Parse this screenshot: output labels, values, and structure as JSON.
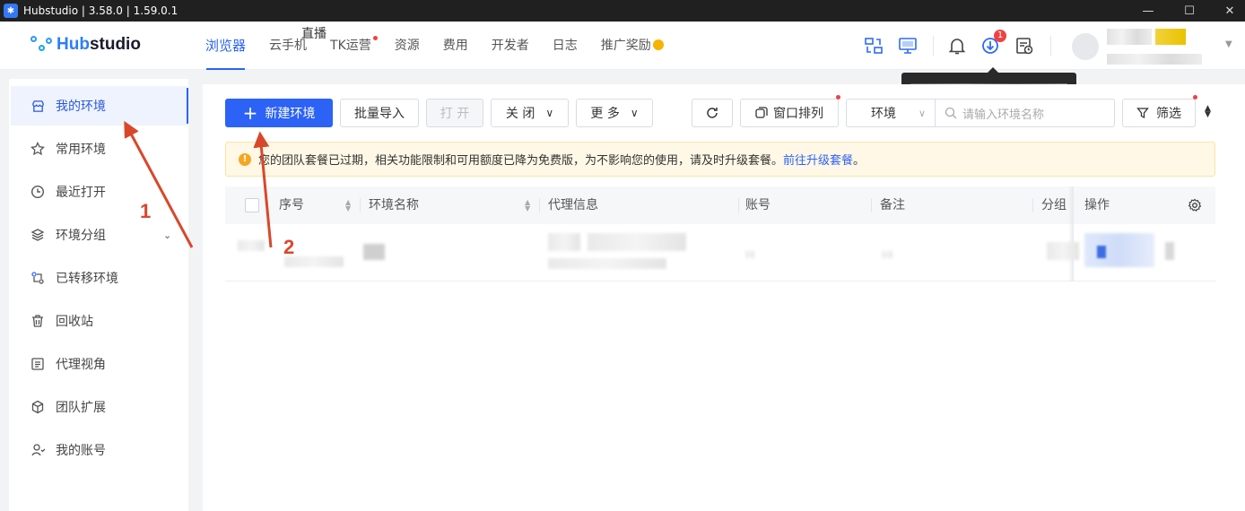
{
  "titlebar": {
    "title": "Hubstudio | 3.58.0 | 1.59.0.1",
    "minimize": "—",
    "maximize": "☐",
    "close": "✕"
  },
  "logo": {
    "prefix": "Hub",
    "suffix": "studio"
  },
  "nav": {
    "items": [
      {
        "label": "浏览器"
      },
      {
        "label": "云手机"
      },
      {
        "label": "TK运营"
      },
      {
        "label": "资源"
      },
      {
        "label": "费用"
      },
      {
        "label": "开发者"
      },
      {
        "label": "日志"
      },
      {
        "label": "推广奖励"
      }
    ],
    "live_badge": "直播",
    "download_count": "1",
    "coin_symbol": "$"
  },
  "sidebar": {
    "items": [
      {
        "label": "我的环境",
        "icon": "store-icon"
      },
      {
        "label": "常用环境",
        "icon": "star-icon"
      },
      {
        "label": "最近打开",
        "icon": "clock-icon"
      },
      {
        "label": "环境分组",
        "icon": "layers-icon"
      },
      {
        "label": "已转移环境",
        "icon": "transfer-icon"
      },
      {
        "label": "回收站",
        "icon": "trash-icon"
      },
      {
        "label": "代理视角",
        "icon": "proxy-icon"
      },
      {
        "label": "团队扩展",
        "icon": "cube-icon"
      },
      {
        "label": "我的账号",
        "icon": "user-icon"
      }
    ]
  },
  "toolbar": {
    "new_env": "新建环境",
    "batch_import": "批量导入",
    "open": "打 开",
    "close": "关 闭",
    "more": "更 多",
    "window_arrange": "窗口排列",
    "env_select": "环境",
    "search_placeholder": "请输入环境名称",
    "filter": "筛选"
  },
  "notice": {
    "text": "您的团队套餐已过期，相关功能限制和可用额度已降为免费版，为不影响您的使用，请及时升级套餐。",
    "link": "前往升级套餐",
    "tail": "。"
  },
  "table": {
    "columns": [
      "序号",
      "环境名称",
      "代理信息",
      "账号",
      "备注",
      "分组",
      "操作"
    ]
  },
  "annotations": {
    "step1": "1",
    "step2": "2"
  },
  "colors": {
    "accent": "#2c63f6",
    "annotation": "#d9472b",
    "notice_bg": "#fff8e6"
  }
}
